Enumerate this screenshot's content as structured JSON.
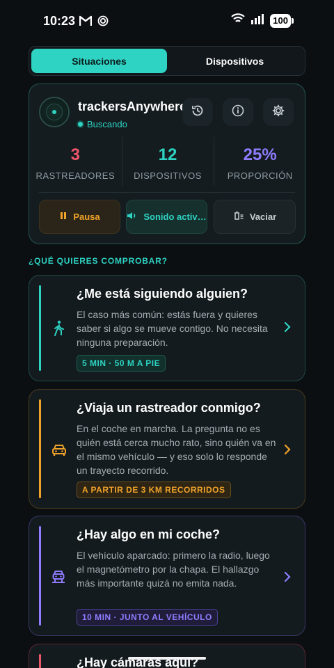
{
  "status_bar": {
    "time": "10:23",
    "battery": "100"
  },
  "tabs": [
    {
      "label": "Situaciones",
      "active": true
    },
    {
      "label": "Dispositivos",
      "active": false
    }
  ],
  "scanner": {
    "app_name": "trackersAnywhere",
    "status": "Buscando",
    "stats": [
      {
        "value": "3",
        "label": "RASTREADORES",
        "color": "#f0566b"
      },
      {
        "value": "12",
        "label": "DISPOSITIVOS",
        "color": "#2ed3c3"
      },
      {
        "value": "25%",
        "label": "PROPORCIÓN",
        "color": "#8f7cff"
      }
    ],
    "actions": {
      "pause": "Pausa",
      "sound": "Sonido activ…",
      "clear": "Vaciar"
    }
  },
  "section_title": "¿QUÉ QUIERES COMPROBAR?",
  "cards": [
    {
      "title": "¿Me está siguiendo alguien?",
      "description": "El caso más común: estás fuera y quieres saber si algo se mueve contigo. No necesita ninguna preparación.",
      "tag": "5 MIN · 50 M A PIE",
      "accent": "#2ed3c3",
      "icon": "walking-person-icon"
    },
    {
      "title": "¿Viaja un rastreador conmigo?",
      "description": "En el coche en marcha. La pregunta no es quién está cerca mucho rato, sino quién va en el mismo vehículo — y eso solo lo responde un trayecto recorrido.",
      "tag": "A PARTIR DE 3 KM RECORRIDOS",
      "accent": "#f2a32a",
      "icon": "car-icon"
    },
    {
      "title": "¿Hay algo en mi coche?",
      "description": "El vehículo aparcado: primero la radio, luego el magnetómetro por la chapa. El hallazgo más importante quizá no emita nada.",
      "tag": "10 MIN · JUNTO AL VEHÍCULO",
      "accent": "#8f7cff",
      "icon": "parked-car-icon"
    },
    {
      "title": "¿Hay cámaras aquí?",
      "accent": "#f0566b"
    }
  ]
}
